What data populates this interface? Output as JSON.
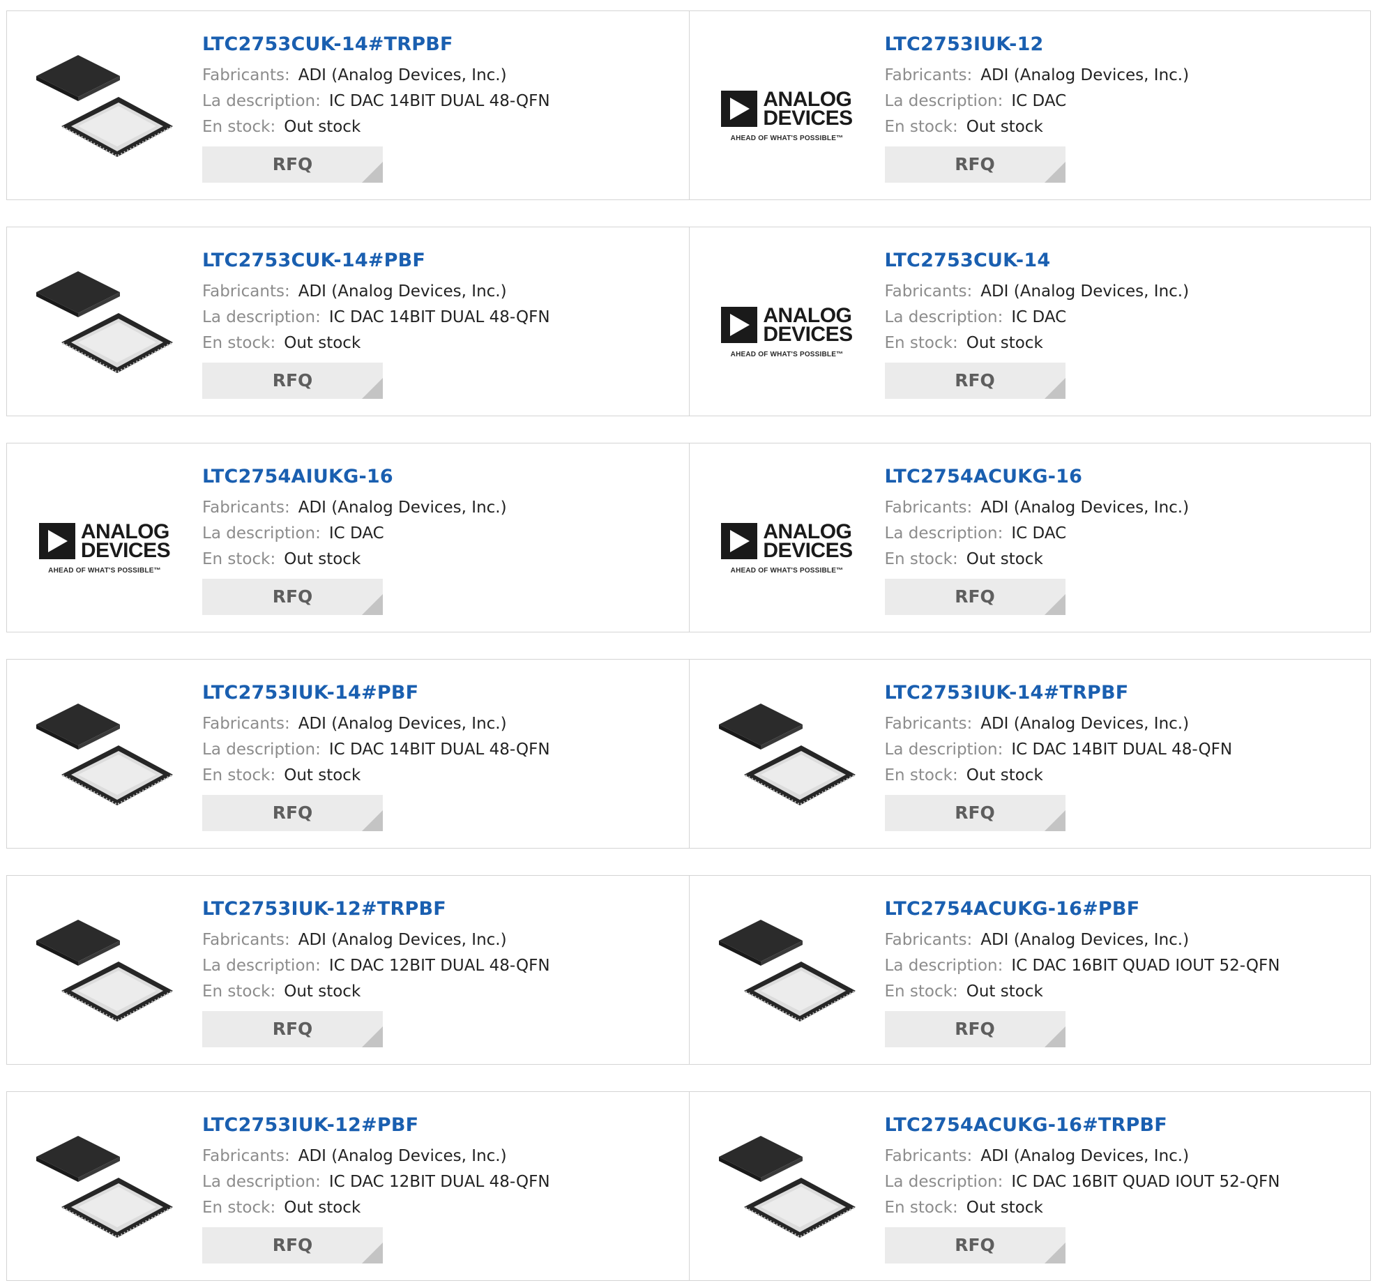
{
  "labels": {
    "manufacturer": "Fabricants:",
    "description": "La description:",
    "stock": "En stock:",
    "rfq": "RFQ"
  },
  "logo": {
    "line1": "ANALOG",
    "line2": "DEVICES",
    "tagline": "AHEAD OF WHAT'S POSSIBLE™"
  },
  "products": [
    {
      "part": "LTC2753CUK-14#TRPBF",
      "manufacturer": "ADI (Analog Devices, Inc.)",
      "description": "IC DAC 14BIT DUAL 48-QFN",
      "stock": "Out stock",
      "image": "qfn-chip-icon"
    },
    {
      "part": "LTC2753IUK-12",
      "manufacturer": "ADI (Analog Devices, Inc.)",
      "description": "IC DAC",
      "stock": "Out stock",
      "image": "analog-devices-logo"
    },
    {
      "part": "LTC2753CUK-14#PBF",
      "manufacturer": "ADI (Analog Devices, Inc.)",
      "description": "IC DAC 14BIT DUAL 48-QFN",
      "stock": "Out stock",
      "image": "qfn-chip-icon"
    },
    {
      "part": "LTC2753CUK-14",
      "manufacturer": "ADI (Analog Devices, Inc.)",
      "description": "IC DAC",
      "stock": "Out stock",
      "image": "analog-devices-logo"
    },
    {
      "part": "LTC2754AIUKG-16",
      "manufacturer": "ADI (Analog Devices, Inc.)",
      "description": "IC DAC",
      "stock": "Out stock",
      "image": "analog-devices-logo"
    },
    {
      "part": "LTC2754ACUKG-16",
      "manufacturer": "ADI (Analog Devices, Inc.)",
      "description": "IC DAC",
      "stock": "Out stock",
      "image": "analog-devices-logo"
    },
    {
      "part": "LTC2753IUK-14#PBF",
      "manufacturer": "ADI (Analog Devices, Inc.)",
      "description": "IC DAC 14BIT DUAL 48-QFN",
      "stock": "Out stock",
      "image": "qfn-chip-icon"
    },
    {
      "part": "LTC2753IUK-14#TRPBF",
      "manufacturer": "ADI (Analog Devices, Inc.)",
      "description": "IC DAC 14BIT DUAL 48-QFN",
      "stock": "Out stock",
      "image": "qfn-chip-icon"
    },
    {
      "part": "LTC2753IUK-12#TRPBF",
      "manufacturer": "ADI (Analog Devices, Inc.)",
      "description": "IC DAC 12BIT DUAL 48-QFN",
      "stock": "Out stock",
      "image": "qfn-chip-icon"
    },
    {
      "part": "LTC2754ACUKG-16#PBF",
      "manufacturer": "ADI (Analog Devices, Inc.)",
      "description": "IC DAC 16BIT QUAD IOUT 52-QFN",
      "stock": "Out stock",
      "image": "qfn-chip-icon"
    },
    {
      "part": "LTC2753IUK-12#PBF",
      "manufacturer": "ADI (Analog Devices, Inc.)",
      "description": "IC DAC 12BIT DUAL 48-QFN",
      "stock": "Out stock",
      "image": "qfn-chip-icon"
    },
    {
      "part": "LTC2754ACUKG-16#TRPBF",
      "manufacturer": "ADI (Analog Devices, Inc.)",
      "description": "IC DAC 16BIT QUAD IOUT 52-QFN",
      "stock": "Out stock",
      "image": "qfn-chip-icon"
    }
  ]
}
